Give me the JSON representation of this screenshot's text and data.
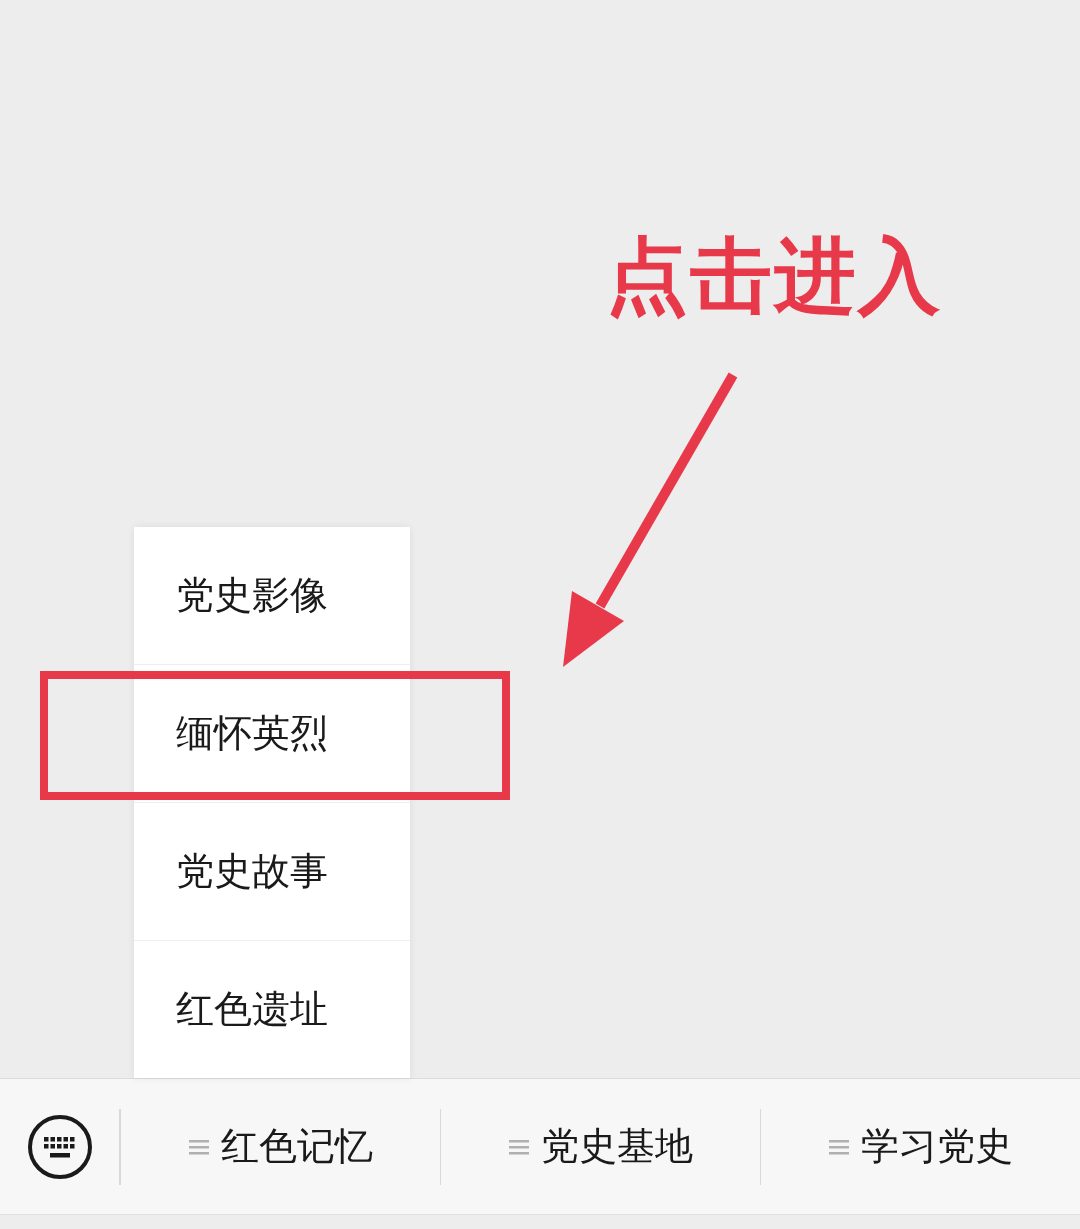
{
  "annotation": {
    "text": "点击进入"
  },
  "popup_menu": {
    "items": [
      {
        "label": "党史影像",
        "highlighted": false
      },
      {
        "label": "缅怀英烈",
        "highlighted": true
      },
      {
        "label": "党史故事",
        "highlighted": false
      },
      {
        "label": "红色遗址",
        "highlighted": false
      }
    ]
  },
  "menu_bar": {
    "buttons": [
      {
        "label": "红色记忆"
      },
      {
        "label": "党史基地"
      },
      {
        "label": "学习党史"
      }
    ]
  }
}
